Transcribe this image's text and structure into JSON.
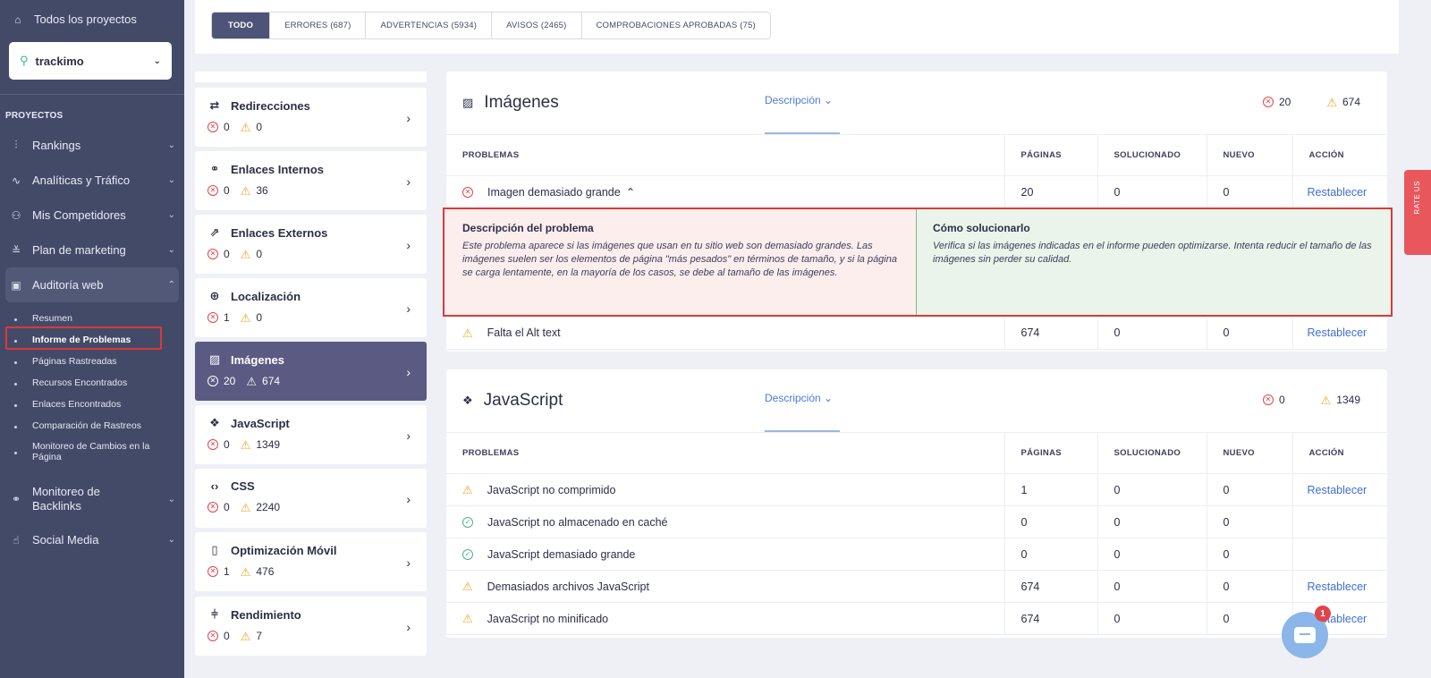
{
  "sidebar": {
    "all_projects": "Todos los proyectos",
    "project": "trackimo",
    "section_label": "PROYECTOS",
    "items": [
      {
        "label": "Rankings",
        "icon": "bar-chart-icon"
      },
      {
        "label": "Analíticas y Tráfico",
        "icon": "pulse-icon"
      },
      {
        "label": "Mis Competidores",
        "icon": "users-icon"
      },
      {
        "label": "Plan de marketing",
        "icon": "list-icon"
      },
      {
        "label": "Auditoría web",
        "icon": "audit-icon"
      }
    ],
    "sub_items": [
      "Resumen",
      "Informe de Problemas",
      "Páginas Rastreadas",
      "Recursos Encontrados",
      "Enlaces Encontrados",
      "Comparación de Rastreos",
      "Monitoreo de Cambios en la Página"
    ],
    "bottom_items": [
      {
        "label": "Monitoreo de Backlinks",
        "icon": "link-icon"
      },
      {
        "label": "Social Media",
        "icon": "thumbs-up-icon"
      }
    ]
  },
  "filters": {
    "tabs": [
      "TODO",
      "ERRORES (687)",
      "ADVERTENCIAS (5934)",
      "AVISOS (2465)",
      "COMPROBACIONES APROBADAS (75)"
    ]
  },
  "categories": [
    {
      "title": "Redirecciones",
      "errors": "0",
      "warnings": "0"
    },
    {
      "title": "Enlaces Internos",
      "errors": "0",
      "warnings": "36"
    },
    {
      "title": "Enlaces Externos",
      "errors": "0",
      "warnings": "0"
    },
    {
      "title": "Localización",
      "errors": "1",
      "warnings": "0"
    },
    {
      "title": "Imágenes",
      "errors": "20",
      "warnings": "674"
    },
    {
      "title": "JavaScript",
      "errors": "0",
      "warnings": "1349"
    },
    {
      "title": "CSS",
      "errors": "0",
      "warnings": "2240"
    },
    {
      "title": "Optimización Móvil",
      "errors": "1",
      "warnings": "476"
    },
    {
      "title": "Rendimiento",
      "errors": "0",
      "warnings": "7"
    }
  ],
  "columns": [
    "PROBLEMAS",
    "PÁGINAS",
    "SOLUCIONADO",
    "NUEVO",
    "ACCIÓN"
  ],
  "images_panel": {
    "title": "Imágenes",
    "desc_label": "Descripción",
    "errors": "20",
    "warnings": "674",
    "rows": [
      {
        "issue": "Imagen demasiado grande",
        "status": "error",
        "pages": "20",
        "fixed": "0",
        "new": "0",
        "action": "Restablecer"
      },
      {
        "issue": "Falta el Alt text",
        "status": "warning",
        "pages": "674",
        "fixed": "0",
        "new": "0",
        "action": "Restablecer"
      }
    ],
    "detail": {
      "problem_title": "Descripción del problema",
      "problem_text": "Este problema aparece si las imágenes que usan en tu sitio web son demasiado grandes. Las imágenes suelen ser los elementos de página \"más pesados\" en términos de tamaño, y si la página se carga lentamente, en la mayoría de los casos, se debe al tamaño de las imágenes.",
      "fix_title": "Cómo solucionarlo",
      "fix_text": "Verifica si las imágenes indicadas en el informe pueden optimizarse. Intenta reducir el tamaño de las imágenes sin perder su calidad."
    }
  },
  "js_panel": {
    "title": "JavaScript",
    "desc_label": "Descripción",
    "errors": "0",
    "warnings": "1349",
    "rows": [
      {
        "issue": "JavaScript no comprimido",
        "status": "warning",
        "pages": "1",
        "fixed": "0",
        "new": "0",
        "action": "Restablecer"
      },
      {
        "issue": "JavaScript no almacenado en caché",
        "status": "ok",
        "pages": "0",
        "fixed": "0",
        "new": "0",
        "action": ""
      },
      {
        "issue": "JavaScript demasiado grande",
        "status": "ok",
        "pages": "0",
        "fixed": "0",
        "new": "0",
        "action": ""
      },
      {
        "issue": "Demasiados archivos JavaScript",
        "status": "warning",
        "pages": "674",
        "fixed": "0",
        "new": "0",
        "action": "Restablecer"
      },
      {
        "issue": "JavaScript no minificado",
        "status": "warning",
        "pages": "674",
        "fixed": "0",
        "new": "0",
        "action": "Restablecer"
      }
    ]
  },
  "feedback_label": "RATE US",
  "chat_badge": "1"
}
